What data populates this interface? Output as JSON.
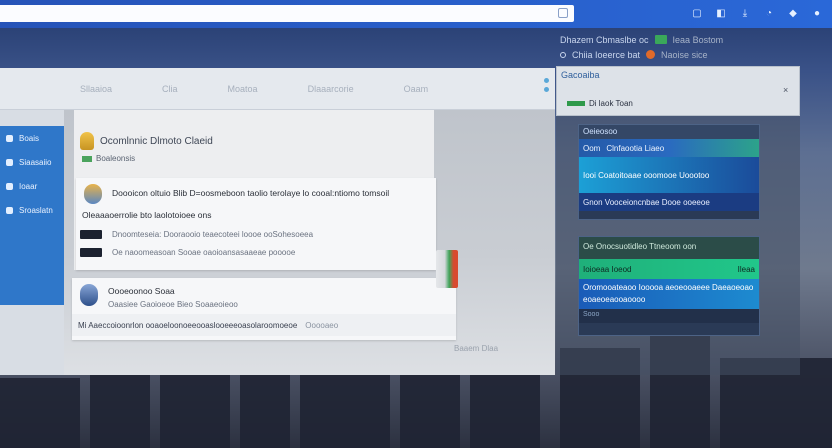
{
  "topbar": {
    "url_placeholder": "",
    "icons": [
      "page-icon",
      "window-icon",
      "sidebar-icon",
      "download-icon",
      "history-icon",
      "extension-icon",
      "profile-icon"
    ]
  },
  "top_right": {
    "row1": "Dhazem Cbmaslbe oc",
    "row1_badge": "Ieaa Bostom",
    "row2": "Chiia Ioeerce bat",
    "row2_extra": "Naoise sice"
  },
  "main": {
    "tabs": [
      "Sllaaioa",
      "Clia",
      "Moatoa",
      "Dlaaarcorie",
      "Oaam"
    ],
    "sidebar": [
      "Boais",
      "Siaasaiio",
      "Ioaar",
      "Sroaslatn"
    ],
    "feed_title": "Ocomlnnic Dlmoto Claeid",
    "feed_sub": "Boaleonsis",
    "post": {
      "line1": "Doooicon oltuio Blib D=oosmeboon taolio terolaye lo cooal:ntiomo tomsoil",
      "line2": "Oleaaaoerrolie bto laolotoioee ons",
      "line3": "Dnoomteseia: Dooraooio teaecoteei loooe ooSohesoeea",
      "line4": "Oe naoomeasoan Sooae oaoioansasaaeae pooooe"
    },
    "post2": {
      "line1": "Oooeoonoo Soaa",
      "line2": "Oaasiee Gaoioeoe Bieo Soaaeoieoo",
      "footer": "Mi Aaeccoioonrlon ooaoeloonoeeooaslooeeeoasolaroomoeoe",
      "footer_muted": "Ooooaeo"
    },
    "content_footer": "Baaem  Dlaa"
  },
  "right_panel": {
    "title": "Gacoaiba",
    "row": "Di laok Toan",
    "close": "×"
  },
  "widgets": {
    "w1": {
      "header": "Oeieosoo",
      "stripe": [
        "Oom",
        "Clnfaootia Liaeo"
      ],
      "news": "Iooi Coatoitoaae ooomooe Uoootoo",
      "news2": "Gnon Vooceioncnbae Dooe ooeeoe"
    },
    "w2": {
      "header": "Oe Onocsuotidleo Ttneoom oon",
      "bar1_left": "Ioioeaa Ioeod",
      "bar1_right": "Ileaa",
      "bar2": "Oromooateaoo Iooooa aeoeooaeee Daeaoeoao eoaeoeaooaoooo",
      "foot": "Sooo"
    }
  }
}
